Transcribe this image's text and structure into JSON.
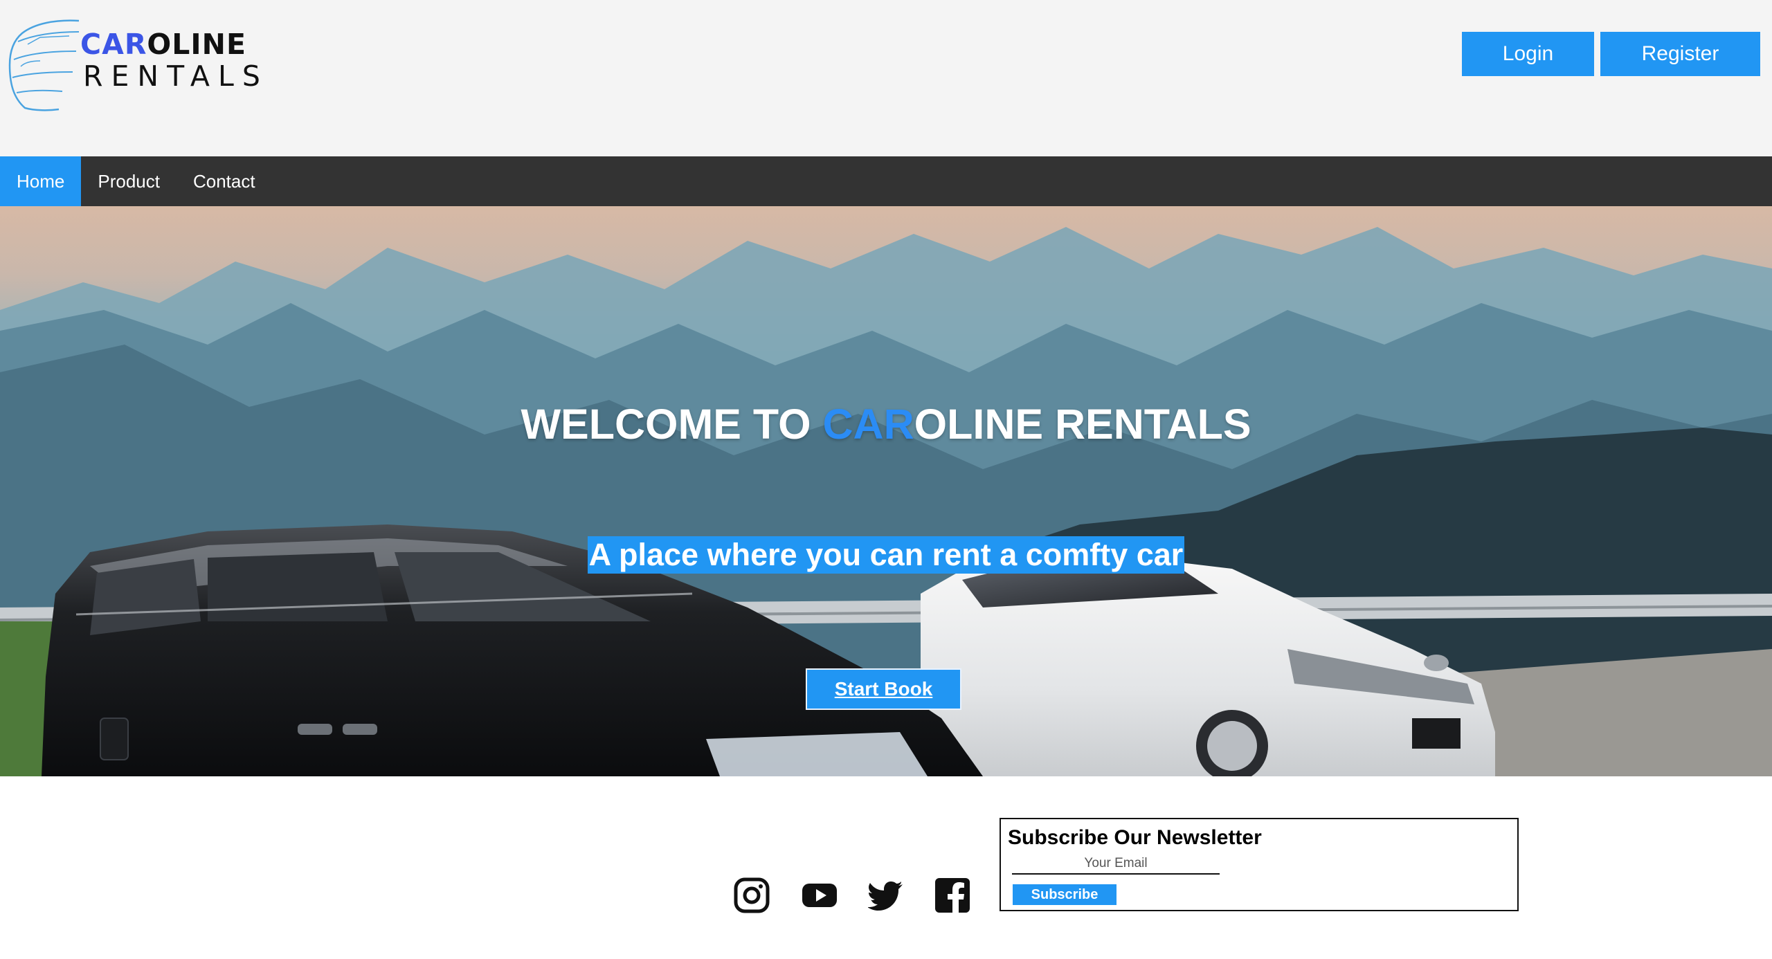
{
  "brand": {
    "logo_top_accent": "CAR",
    "logo_top_rest": "OLINE",
    "logo_bottom": "RENTALS",
    "accent_color": "#3b55e6"
  },
  "header": {
    "login_label": "Login",
    "register_label": "Register"
  },
  "nav": {
    "items": [
      {
        "label": "Home",
        "active": true
      },
      {
        "label": "Product",
        "active": false
      },
      {
        "label": "Contact",
        "active": false
      }
    ]
  },
  "hero": {
    "title_prefix": "WELCOME TO ",
    "title_accent": "CAR",
    "title_suffix": "OLINE RENTALS",
    "subtitle": "A place where you can rent a comfty car",
    "cta_label": "Start Book"
  },
  "footer": {
    "social_icons": [
      "instagram-icon",
      "youtube-icon",
      "twitter-icon",
      "facebook-icon"
    ],
    "newsletter": {
      "title": "Subscribe Our Newsletter",
      "email_placeholder": "Your Email",
      "subscribe_label": "Subscribe"
    }
  },
  "colors": {
    "primary": "#2196f3",
    "nav_bg": "#333333",
    "header_bg": "#f4f4f4"
  }
}
